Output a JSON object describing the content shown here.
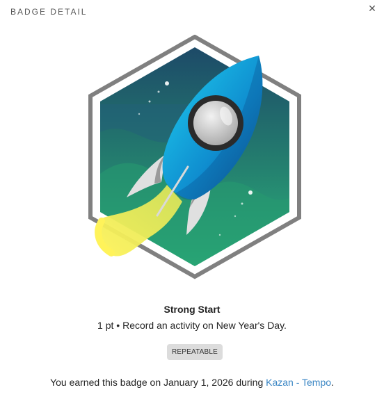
{
  "dialog": {
    "title": "BADGE DETAIL",
    "close_icon": "close-icon"
  },
  "badge": {
    "name": "Strong Start",
    "points": "1 pt",
    "separator": "•",
    "description": "Record an activity on New Year's Day.",
    "tag": "REPEATABLE",
    "art_icon": "rocket-icon"
  },
  "earned": {
    "prefix": "You earned this badge on January 1, 2026 during",
    "event_link": "Kazan - Tempo",
    "suffix": "."
  },
  "colors": {
    "link": "#3a86c4",
    "tag_bg": "#dcdcdc",
    "hex_bg_top": "#1d4f6b",
    "hex_bg_bottom": "#2aa879",
    "rocket_body": "#15b6e6",
    "flame": "#f4ec5a"
  }
}
